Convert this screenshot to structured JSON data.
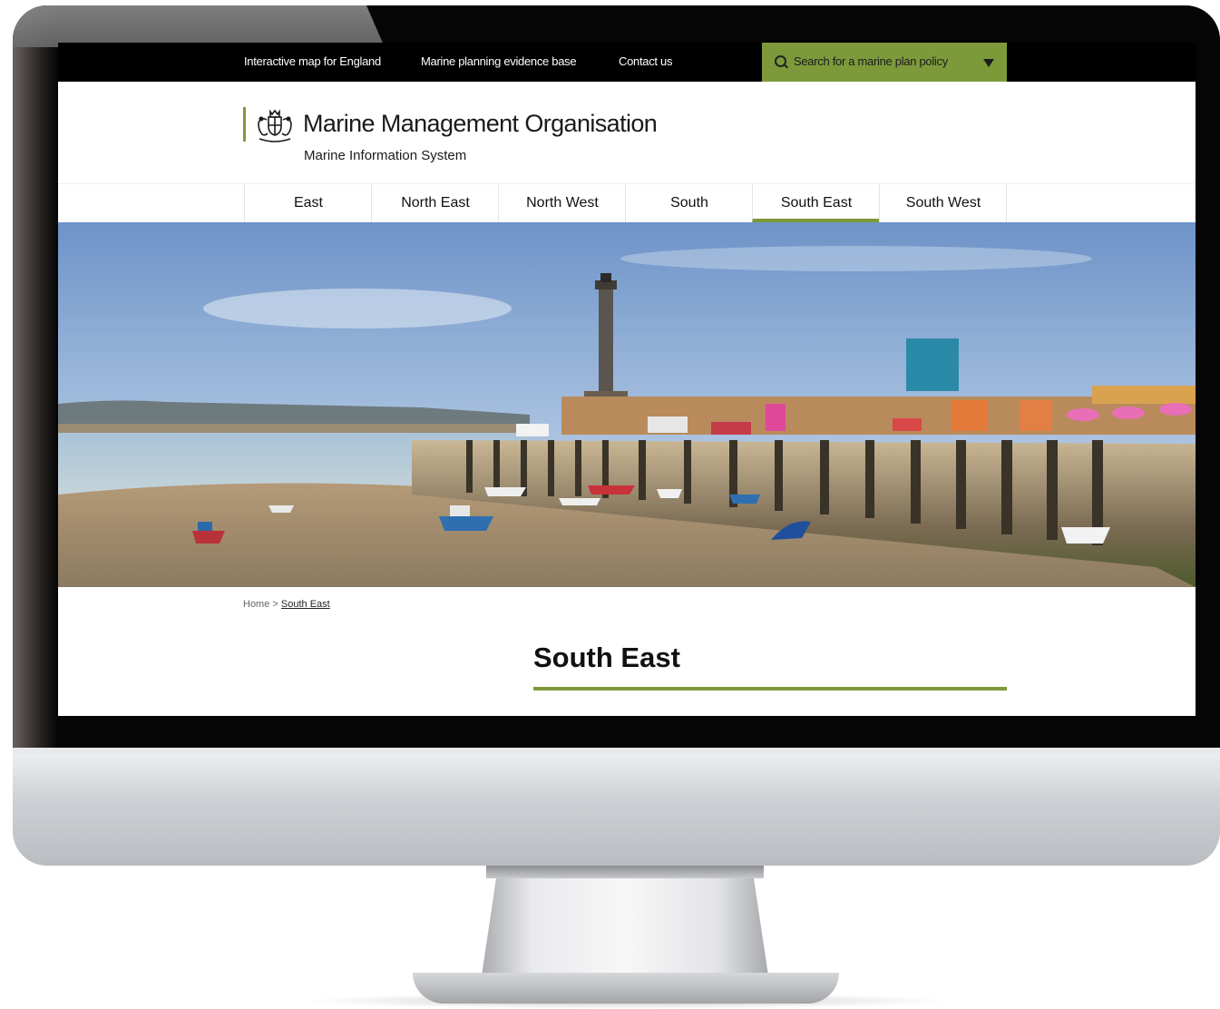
{
  "topbar": {
    "links": [
      "Interactive map for England",
      "Marine planning evidence base",
      "Contact us"
    ],
    "search_label": "Search for a marine plan policy"
  },
  "header": {
    "org_name": "Marine Management Organisation",
    "subtitle": "Marine Information System"
  },
  "nav": {
    "items": [
      "East",
      "North East",
      "North West",
      "South",
      "South East",
      "South West"
    ],
    "active": "South East"
  },
  "breadcrumb": {
    "home": "Home",
    "separator": ">",
    "current": "South East"
  },
  "page": {
    "title": "South East"
  },
  "colors": {
    "accent": "#7d9a3b",
    "topbar": "#000000"
  },
  "icons": {
    "search": "search-icon",
    "dropdown": "triangle-down-icon",
    "crest": "royal-crest-icon"
  }
}
